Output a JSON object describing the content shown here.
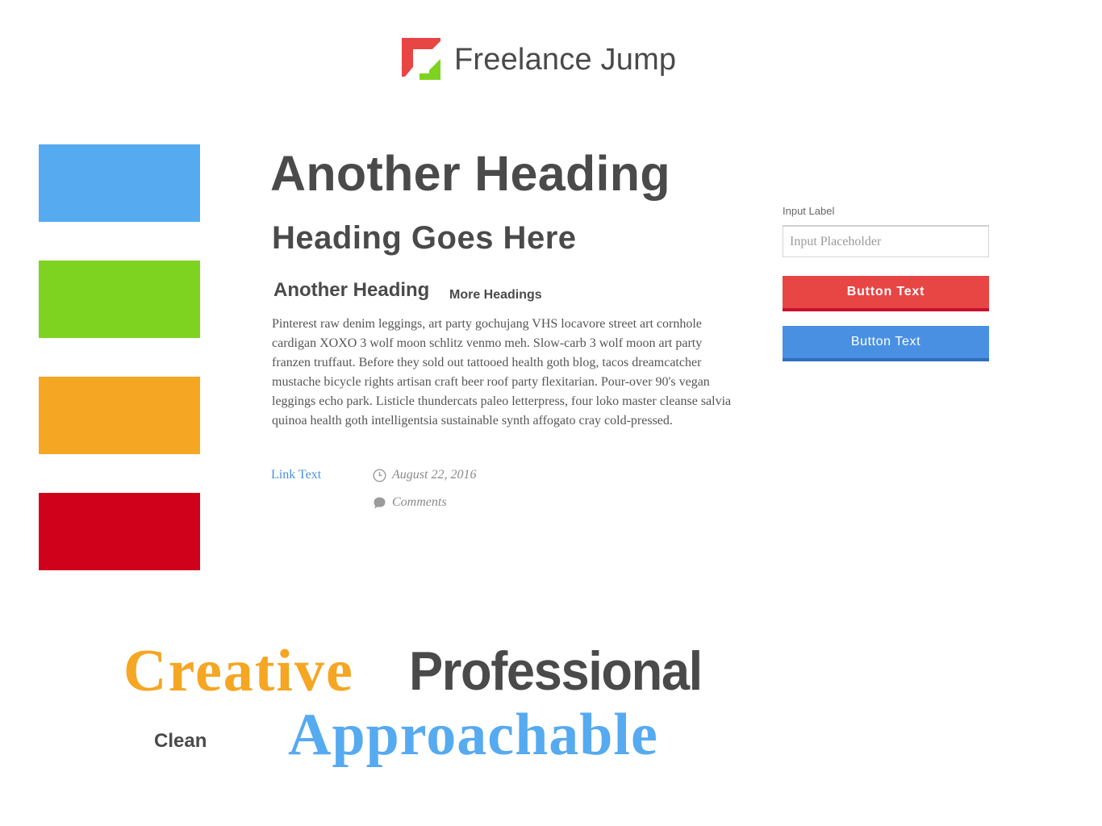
{
  "brand": {
    "name": "Freelance Jump",
    "colors": {
      "red": "#e84545",
      "green": "#7ed321",
      "text": "#4a4a4a"
    }
  },
  "swatches": [
    {
      "name": "blue",
      "color": "#56aaf0"
    },
    {
      "name": "green",
      "color": "#7ed321"
    },
    {
      "name": "orange",
      "color": "#f5a623"
    },
    {
      "name": "red",
      "color": "#d0021b"
    }
  ],
  "typography": {
    "h1": "Another Heading",
    "h2": "Heading Goes Here",
    "h3": "Another Heading",
    "h4": "More Headings",
    "body": "Pinterest raw denim leggings, art party gochujang VHS locavore street art cornhole cardigan XOXO 3 wolf moon schlitz venmo meh.  Slow-carb 3 wolf moon art party franzen truffaut.  Before they sold out tattooed health goth blog, tacos dreamcatcher mustache bicycle rights artisan craft beer roof party flexitarian.  Pour-over 90's vegan leggings echo park.  Listicle thundercats paleo letterpress, four loko master cleanse salvia quinoa health goth intelligentsia sustainable synth affogato cray cold-pressed.",
    "link": "Link Text",
    "link_color": "#4a90e2"
  },
  "meta": {
    "date": "August 22, 2016",
    "date_icon": "clock-icon",
    "comments": "Comments",
    "comments_icon": "comment-bubble-icon"
  },
  "form": {
    "input_label": "Input Label",
    "input_placeholder": "Input Placeholder",
    "input_value": "",
    "primary_button": "Button Text",
    "primary_color": "#e84545",
    "secondary_button": "Button Text",
    "secondary_color": "#4a90e2"
  },
  "brand_words": {
    "creative": "Creative",
    "professional": "Professional",
    "clean": "Clean",
    "approachable": "Approachable"
  }
}
